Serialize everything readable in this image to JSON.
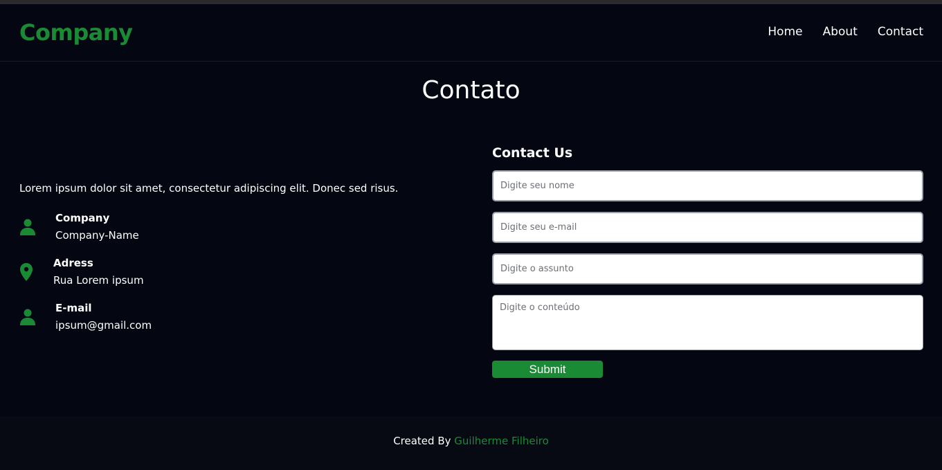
{
  "header": {
    "brand": "Company",
    "nav": [
      {
        "label": "Home"
      },
      {
        "label": "About"
      },
      {
        "label": "Contact"
      }
    ]
  },
  "page": {
    "title": "Contato"
  },
  "info": {
    "intro": "Lorem ipsum dolor sit amet, consectetur adipiscing elit. Donec sed risus.",
    "items": [
      {
        "icon": "user-icon",
        "label": "Company",
        "value": "Company-Name"
      },
      {
        "icon": "location-pin-icon",
        "label": "Adress",
        "value": "Rua Lorem ipsum"
      },
      {
        "icon": "user-icon",
        "label": "E-mail",
        "value": "ipsum@gmail.com"
      }
    ]
  },
  "form": {
    "title": "Contact Us",
    "name_placeholder": "Digite seu nome",
    "email_placeholder": "Digite seu e-mail",
    "subject_placeholder": "Digite o assunto",
    "content_placeholder": "Digite o conteúdo",
    "submit_label": "Submit"
  },
  "footer": {
    "prefix": "Created By",
    "author": "Guilherme Filheiro"
  },
  "colors": {
    "background": "#040712",
    "accent": "#1b8a35",
    "text": "#ffffff"
  }
}
